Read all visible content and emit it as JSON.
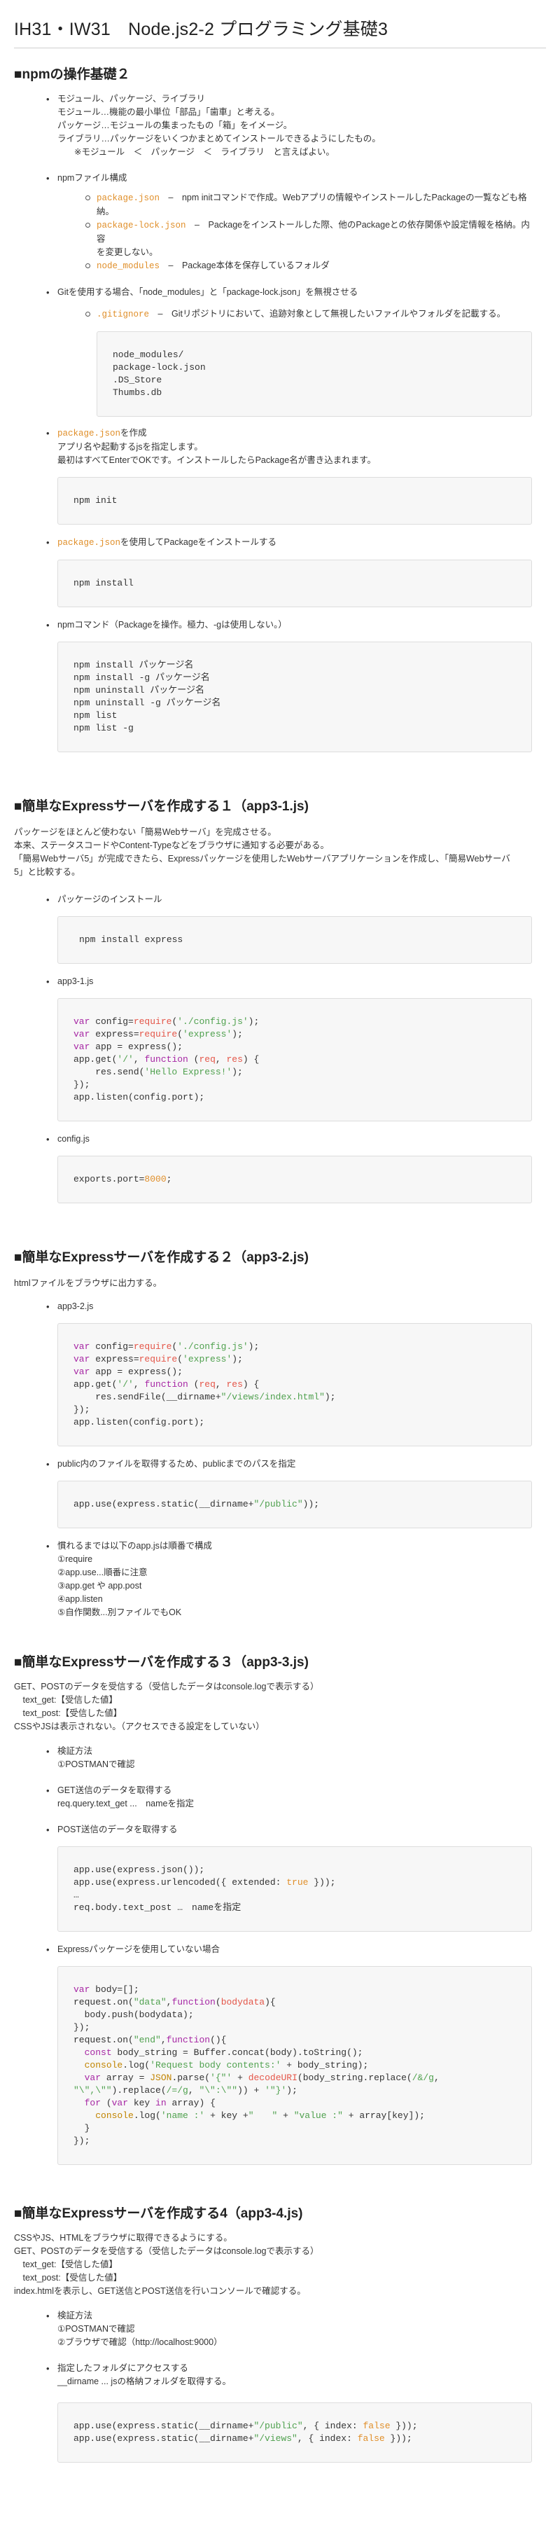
{
  "title": "IH31・IW31　Node.js2-2 プログラミング基礎3",
  "s1": {
    "heading": "■npmの操作基礎２",
    "modules": {
      "head": "モジュール、パッケージ、ライブラリ",
      "lines": [
        "モジュール…機能の最小単位「部品」「歯車」と考える。",
        "パッケージ…モジュールの集まったもの「箱」をイメージ。",
        "ライブラリ…パッケージをいくつかまとめてインストールできるようにしたもの。",
        "※モジュール　＜　パッケージ　＜　ライブラリ　と言えばよい。"
      ]
    },
    "npmfiles": {
      "head": "npmファイル構成",
      "items": [
        {
          "code": "package.json",
          "text": "　–　npm initコマンドで作成。Webアプリの情報やインストールしたPackageの一覧なども格",
          "cont": "納。"
        },
        {
          "code": "package-lock.json",
          "text": "　–　Packageをインストールした際、他のPackageとの依存関係や設定情報を格納。内容",
          "cont": "を変更しない。"
        },
        {
          "code": "node_modules",
          "text": "　–　Package本体を保存しているフォルダ"
        }
      ]
    },
    "gitignore": {
      "head": "Gitを使用する場合、「node_modules」と「package-lock.json」を無視させる",
      "code": ".gitignore",
      "text": "　–　Gitリポジトリにおいて、追跡対象として無視したいファイルやフォルダを記載する。",
      "pre": "node_modules/\npackage-lock.json\n.DS_Store\nThumbs.db"
    },
    "pkgjson": {
      "code": "package.json",
      "text": "を作成",
      "lines": [
        "アプリ名や起動するjsを指定します。",
        "最初はすべてEnterでOKです。インストールしたらPackage名が書き込まれます。"
      ],
      "pre": "npm init"
    },
    "pkginstall": {
      "code": "package.json",
      "text": "を使用してPackageをインストールする",
      "pre": "npm install"
    },
    "npmcmd": {
      "head": "npmコマンド（Packageを操作。極力、-gは使用しない。）",
      "pre": "npm install パッケージ名\nnpm install -g パッケージ名\nnpm uninstall パッケージ名\nnpm uninstall -g パッケージ名\nnpm list\nnpm list -g"
    }
  },
  "s2": {
    "heading": "■簡単なExpressサーバを作成する１（app3-1.js)",
    "lines": [
      "パッケージをほとんど使わない「簡易Webサーバ」を完成させる。",
      "本来、ステータスコードやContent-Typeなどをブラウザに通知する必要がある。",
      "「簡易Webサーバ5」が完成できたら、Expressパッケージを使用したWebサーバアプリケーションを作成し、「簡易Webサーバ",
      "5」と比較する。"
    ],
    "install_head": "パッケージのインストール",
    "install_pre": "npm install express",
    "app_head": "app3-1.js",
    "config_head": "config.js",
    "port": "8000"
  },
  "s3": {
    "heading": "■簡単なExpressサーバを作成する２（app3-2.js)",
    "line": "htmlファイルをブラウザに出力する。",
    "app_head": "app3-2.js",
    "public_head": "public内のファイルを取得するため、publicまでのパスを指定",
    "memo_head": "慣れるまでは以下のapp.jsは順番で構成",
    "memo": [
      "①require",
      "②app.use...順番に注意",
      "③app.get や app.post",
      "④app.listen",
      "⑤自作関数...別ファイルでもOK"
    ]
  },
  "s4": {
    "heading": "■簡単なExpressサーバを作成する３（app3-3.js)",
    "lines": [
      "GET、POSTのデータを受信する（受信したデータはconsole.logで表示する）",
      "　text_get:【受信した値】",
      "　text_post:【受信した値】",
      "CSSやJSは表示されない。（アクセスできる設定をしていない）"
    ],
    "verify_head": "検証方法",
    "verify": [
      "①POSTMANで確認"
    ],
    "get_head": "GET送信のデータを取得する",
    "get_line": "req.query.text_get ...　nameを指定",
    "post_head": "POST送信のデータを取得する",
    "noexp_head": "Expressパッケージを使用していない場合"
  },
  "s5": {
    "heading": "■簡単なExpressサーバを作成する4（app3-4.js)",
    "lines": [
      "CSSやJS、HTMLをブラウザに取得できるようにする。",
      "GET、POSTのデータを受信する（受信したデータはconsole.logで表示する）",
      "　text_get:【受信した値】",
      "　text_post:【受信した値】",
      "index.htmlを表示し、GET送信とPOST送信を行いコンソールで確認する。"
    ],
    "verify_head": "検証方法",
    "verify": [
      "①POSTMANで確認",
      "②ブラウザで確認（http://localhost:9000）"
    ],
    "folder_head": "指定したフォルダにアクセスする",
    "folder_line": "__dirname ... jsの格納フォルダを取得する。"
  }
}
